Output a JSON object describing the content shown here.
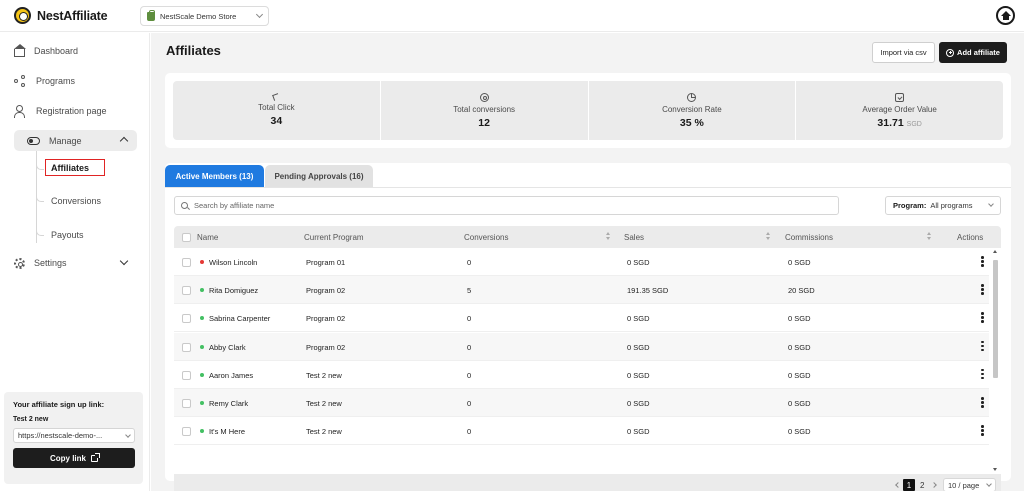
{
  "app": {
    "name": "NestAffiliate",
    "store": "NestScale Demo Store"
  },
  "sidebar": {
    "items": [
      {
        "label": "Dashboard"
      },
      {
        "label": "Programs"
      },
      {
        "label": "Registration page"
      },
      {
        "label": "Manage"
      },
      {
        "label": "Settings"
      }
    ],
    "manage_sub": [
      {
        "label": "Affiliates"
      },
      {
        "label": "Conversions"
      },
      {
        "label": "Payouts"
      }
    ],
    "signup": {
      "title": "Your affiliate sign up link:",
      "program": "Test 2 new",
      "link": "https://nestscale-demo-...",
      "copy_label": "Copy link"
    }
  },
  "header": {
    "title": "Affiliates",
    "import_label": "Import via csv",
    "add_label": "Add affiliate"
  },
  "stats": [
    {
      "label": "Total Click",
      "value": "34",
      "unit": ""
    },
    {
      "label": "Total conversions",
      "value": "12",
      "unit": ""
    },
    {
      "label": "Conversion Rate",
      "value": "35 %",
      "unit": ""
    },
    {
      "label": "Average Order Value",
      "value": "31.71",
      "unit": "SGD"
    }
  ],
  "tabs": [
    {
      "label": "Active Members (13)",
      "active": true
    },
    {
      "label": "Pending Approvals (16)",
      "active": false
    }
  ],
  "search": {
    "placeholder": "Search by affiliate name"
  },
  "program_filter": {
    "label": "Program:",
    "value": "All programs"
  },
  "columns": {
    "name": "Name",
    "program": "Current Program",
    "conversions": "Conversions",
    "sales": "Sales",
    "commissions": "Commissions",
    "actions": "Actions"
  },
  "rows": [
    {
      "name": "Wilson Lincoln",
      "status_color": "#e53935",
      "program": "Program 01",
      "conversions": "0",
      "sales": "0 SGD",
      "commissions": "0 SGD"
    },
    {
      "name": "Rita Domiguez",
      "status_color": "#43c063",
      "program": "Program 02",
      "conversions": "5",
      "sales": "191.35 SGD",
      "commissions": "20 SGD"
    },
    {
      "name": "Sabrina Carpenter",
      "status_color": "#43c063",
      "program": "Program 02",
      "conversions": "0",
      "sales": "0 SGD",
      "commissions": "0 SGD"
    },
    {
      "name": "Abby Clark",
      "status_color": "#43c063",
      "program": "Program 02",
      "conversions": "0",
      "sales": "0 SGD",
      "commissions": "0 SGD"
    },
    {
      "name": "Aaron James",
      "status_color": "#43c063",
      "program": "Test 2 new",
      "conversions": "0",
      "sales": "0 SGD",
      "commissions": "0 SGD"
    },
    {
      "name": "Remy Clark",
      "status_color": "#43c063",
      "program": "Test 2 new",
      "conversions": "0",
      "sales": "0 SGD",
      "commissions": "0 SGD"
    },
    {
      "name": "It's M Here",
      "status_color": "#43c063",
      "program": "Test 2 new",
      "conversions": "0",
      "sales": "0 SGD",
      "commissions": "0 SGD"
    }
  ],
  "pagination": {
    "current": "1",
    "next_page": "2",
    "page_size": "10 / page"
  },
  "colors": {
    "accent": "#1f7ae0",
    "dark": "#1d1d1d",
    "active_dot": "#43c063",
    "inactive_dot": "#e53935",
    "highlight_border": "#e02424"
  }
}
